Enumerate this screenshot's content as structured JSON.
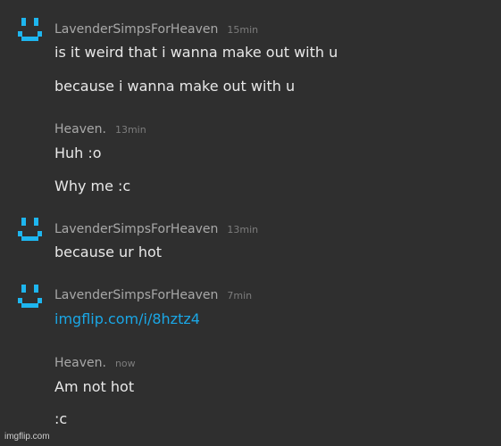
{
  "accent_color": "#1eb6ef",
  "messages": [
    {
      "author": "LavenderSimpsForHeaven",
      "time": "15min",
      "lines": [
        "is it weird that i wanna make out with u",
        "because i wanna make out with u"
      ],
      "avatar_icon": "smiley-icon"
    },
    {
      "author": "Heaven.",
      "time": "13min",
      "lines": [
        "Huh :o",
        "Why me :c"
      ]
    },
    {
      "author": "LavenderSimpsForHeaven",
      "time": "13min",
      "lines": [
        "because ur hot"
      ],
      "avatar_icon": "smiley-icon"
    },
    {
      "author": "LavenderSimpsForHeaven",
      "time": "7min",
      "lines": [
        "imgflip.com/i/8hztz4"
      ],
      "avatar_icon": "smiley-icon"
    },
    {
      "author": "Heaven.",
      "time": "now",
      "lines": [
        "Am not hot",
        ":c"
      ]
    }
  ],
  "watermark": "imgflip.com"
}
